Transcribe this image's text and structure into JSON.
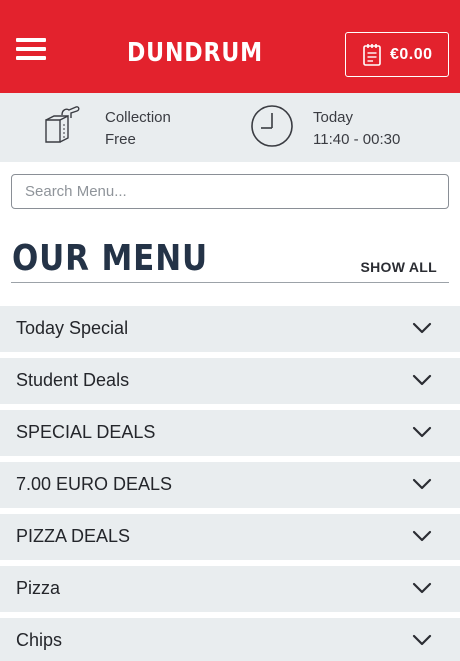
{
  "header": {
    "brand": "DUNDRUM",
    "cart_total": "€0.00",
    "menu_icon": "hamburger-menu-icon",
    "cart_icon": "receipt-icon",
    "accent_color": "#e3222d"
  },
  "info": {
    "collection_label": "Collection",
    "collection_value": "Free",
    "time_label": "Today",
    "time_value": "11:40 - 00:30"
  },
  "search": {
    "placeholder": "Search Menu..."
  },
  "menu": {
    "title": "OUR MENU",
    "show_all": "SHOW ALL",
    "categories": [
      {
        "label": "Today Special"
      },
      {
        "label": "Student Deals"
      },
      {
        "label": "SPECIAL DEALS"
      },
      {
        "label": "7.00 EURO DEALS"
      },
      {
        "label": "PIZZA DEALS"
      },
      {
        "label": "Pizza"
      },
      {
        "label": "Chips"
      }
    ]
  }
}
